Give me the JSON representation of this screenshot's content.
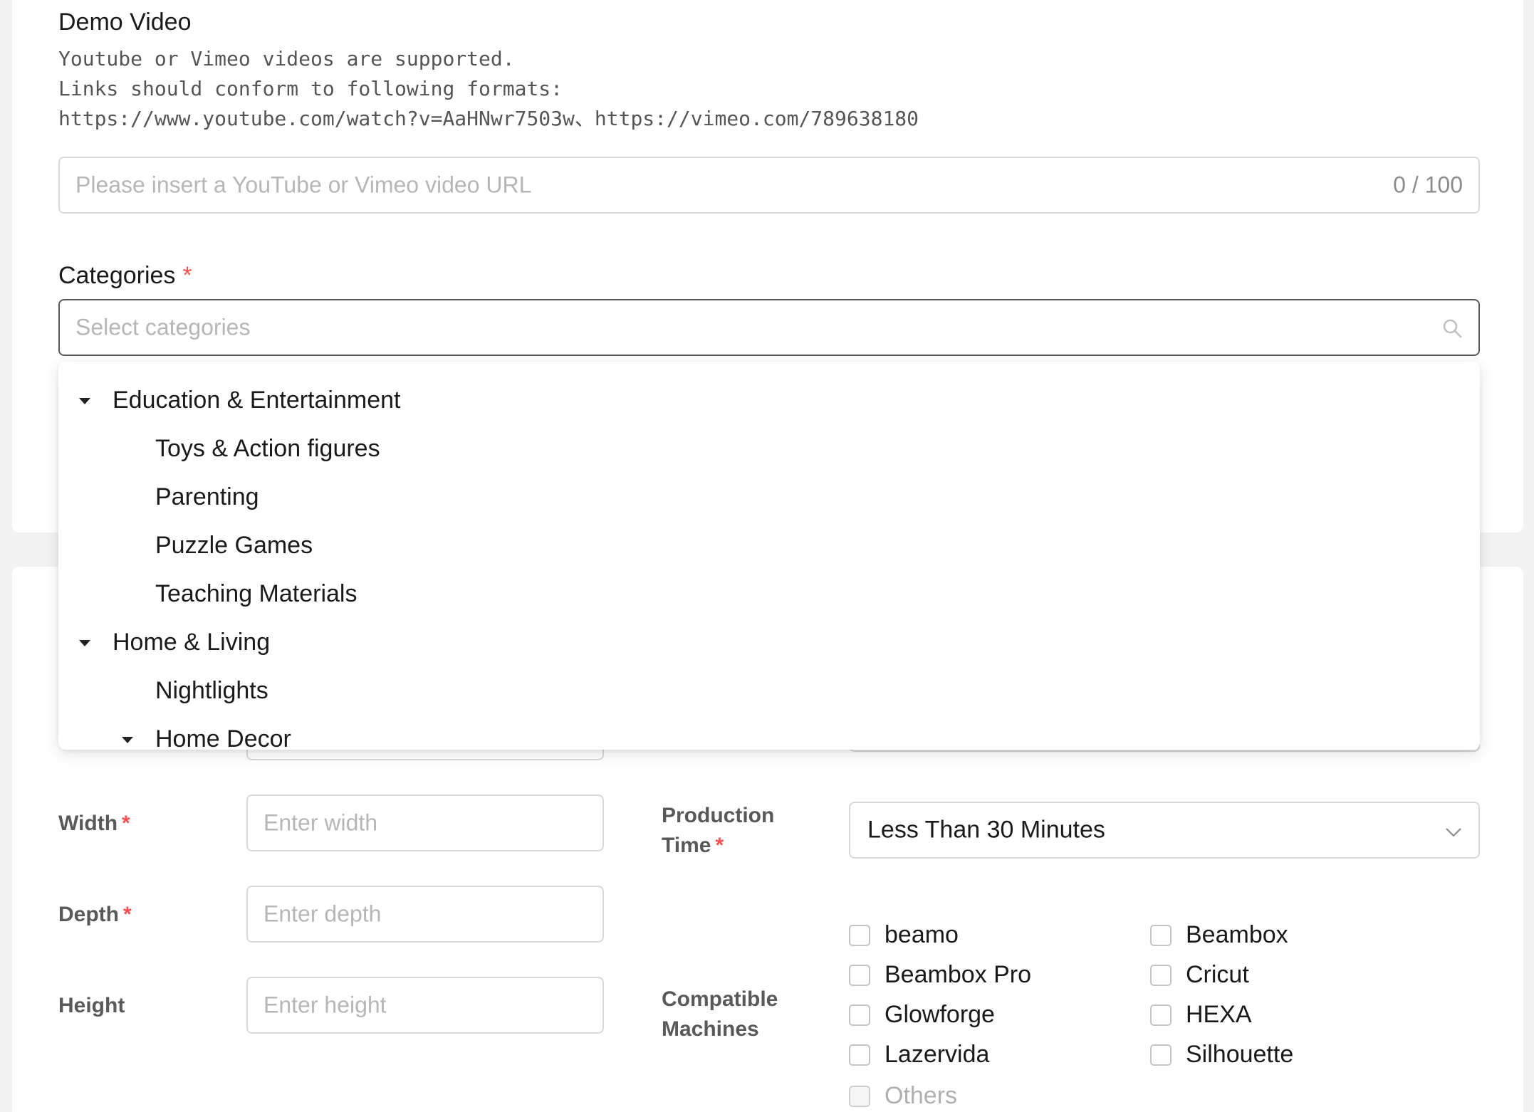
{
  "demo_video": {
    "title": "Demo Video",
    "hint_lines": [
      "Youtube or Vimeo videos are supported.",
      "Links should conform to following formats:",
      "https://www.youtube.com/watch?v=AaHNwr7503w、https://vimeo.com/789638180"
    ],
    "placeholder": "Please insert a YouTube or Vimeo video URL",
    "counter": "0 / 100"
  },
  "categories": {
    "label": "Categories",
    "required_mark": "*",
    "placeholder": "Select categories",
    "tree": [
      {
        "label": "Education & Entertainment",
        "expanded": true,
        "level": 0
      },
      {
        "label": "Toys & Action figures",
        "level": 1
      },
      {
        "label": "Parenting",
        "level": 1
      },
      {
        "label": "Puzzle Games",
        "level": 1
      },
      {
        "label": "Teaching Materials",
        "level": 1
      },
      {
        "label": "Home & Living",
        "expanded": true,
        "level": 0
      },
      {
        "label": "Nightlights",
        "level": 1
      },
      {
        "label": "Home Decor",
        "expanded": true,
        "level": 1
      }
    ]
  },
  "dimensions": {
    "width": {
      "label": "Width",
      "required_mark": "*",
      "placeholder": "Enter width"
    },
    "depth": {
      "label": "Depth",
      "required_mark": "*",
      "placeholder": "Enter depth"
    },
    "height": {
      "label": "Height",
      "placeholder": "Enter height"
    }
  },
  "production_time": {
    "label_line1": "Production",
    "label_line2": "Time",
    "required_mark": "*",
    "value": "Less Than 30 Minutes"
  },
  "compatible_machines": {
    "label_line1": "Compatible",
    "label_line2": "Machines",
    "options": [
      "beamo",
      "Beambox",
      "Beambox Pro",
      "Cricut",
      "Glowforge",
      "HEXA",
      "Lazervida",
      "Silhouette"
    ],
    "other": "Others"
  },
  "colors": {
    "required": "#ff4d4f",
    "border": "#d9d9d9",
    "focused_border": "#595959"
  }
}
